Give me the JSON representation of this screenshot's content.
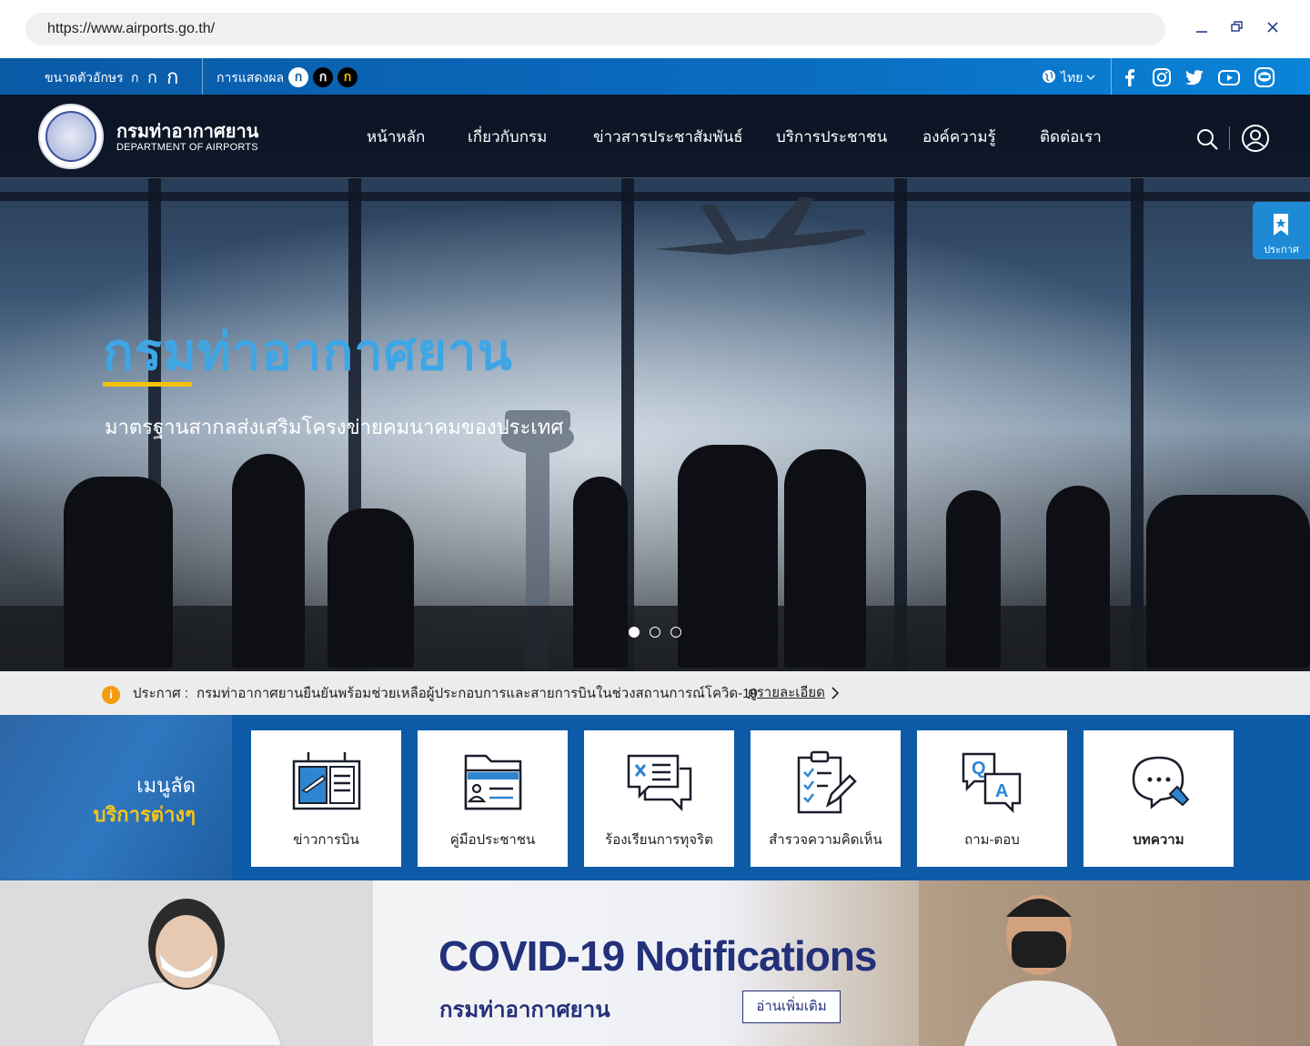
{
  "browser": {
    "url": "https://www.airports.go.th/"
  },
  "utility": {
    "font_size_label": "ขนาดตัวอักษร",
    "font_sizes": [
      "ก",
      "ก",
      "ก"
    ],
    "display_label": "การแสดงผล",
    "display_modes": [
      "ก",
      "ก",
      "ก"
    ],
    "language": "ไทย"
  },
  "logo": {
    "name_th": "กรมท่าอากาศยาน",
    "name_en": "DEPARTMENT OF AIRPORTS"
  },
  "nav": {
    "items": [
      "หน้าหลัก",
      "เกี่ยวกับกรม",
      "ข่าวสารประชาสัมพันธ์",
      "บริการประชาชน",
      "องค์ความรู้",
      "ติดต่อเรา"
    ]
  },
  "hero": {
    "title": "กรมท่าอากาศยาน",
    "subtitle": "มาตรฐานสากลส่งเสริมโครงข่ายคมนาคมของประเทศ",
    "slides": 3,
    "active_slide": 1
  },
  "announce_tab": {
    "label": "ประกาศ"
  },
  "notice": {
    "label": "ประกาศ :",
    "text": "กรมท่าอากาศยานยืนยันพร้อมช่วยเหลือผู้ประกอบการและสายการบินในช่วงสถานการณ์โควิด-19",
    "link": "ดูรายละเอียด"
  },
  "quick_menu": {
    "title_line1": "เมนูลัด",
    "title_line2": "บริการต่างๆ",
    "items": [
      {
        "label": "ข่าวการบิน",
        "icon": "flight-board-icon"
      },
      {
        "label": "คู่มือประชาชน",
        "icon": "folder-id-icon"
      },
      {
        "label": "ร้องเรียนการทุจริต",
        "icon": "complaint-chat-icon"
      },
      {
        "label": "สำรวจความคิดเห็น",
        "icon": "survey-clipboard-icon"
      },
      {
        "label": "ถาม-ตอบ",
        "icon": "qa-icon"
      },
      {
        "label": "บทความ",
        "icon": "article-chat-icon"
      }
    ]
  },
  "covid": {
    "title": "COVID-19 Notifications",
    "subtitle": "กรมท่าอากาศยาน",
    "button": "อ่านเพิ่มเติม"
  },
  "colors": {
    "primary": "#0d5ba7",
    "accent": "#f2c300",
    "hero_title": "#3fa6e6",
    "covid_text": "#23307a"
  }
}
